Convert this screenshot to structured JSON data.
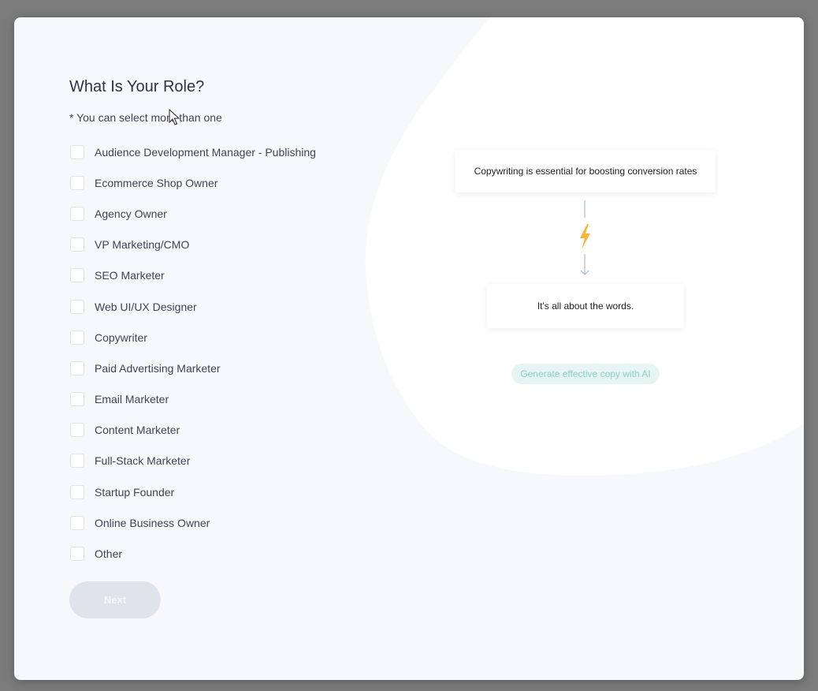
{
  "form": {
    "title": "What Is Your Role?",
    "hint": "* You can select more than one",
    "options": [
      {
        "label": "Audience Development Manager - Publishing",
        "checked": false
      },
      {
        "label": "Ecommerce Shop Owner",
        "checked": false
      },
      {
        "label": "Agency Owner",
        "checked": false
      },
      {
        "label": "VP Marketing/CMO",
        "checked": false
      },
      {
        "label": "SEO Marketer",
        "checked": false
      },
      {
        "label": "Web UI/UX Designer",
        "checked": false
      },
      {
        "label": "Copywriter",
        "checked": false
      },
      {
        "label": "Paid Advertising Marketer",
        "checked": false
      },
      {
        "label": "Email Marketer",
        "checked": false
      },
      {
        "label": "Content Marketer",
        "checked": false
      },
      {
        "label": "Full-Stack Marketer",
        "checked": false
      },
      {
        "label": "Startup Founder",
        "checked": false
      },
      {
        "label": "Online Business Owner",
        "checked": false
      },
      {
        "label": "Other",
        "checked": false
      }
    ],
    "next_label": "Next",
    "next_enabled": false
  },
  "illustration": {
    "top_card_text": "Copywriting is essential for boosting conversion rates",
    "bottom_card_text": "It's all about the words.",
    "ai_pill_text": "Generate effective copy with AI",
    "bolt_color": "#f4b63c",
    "arrow_color": "#a9b8d4",
    "pill_text_color": "#8dcfc1"
  },
  "icons": {
    "bolt": "lightning-bolt-icon",
    "arrow": "arrow-down-icon",
    "cursor": "mouse-cursor-icon"
  }
}
